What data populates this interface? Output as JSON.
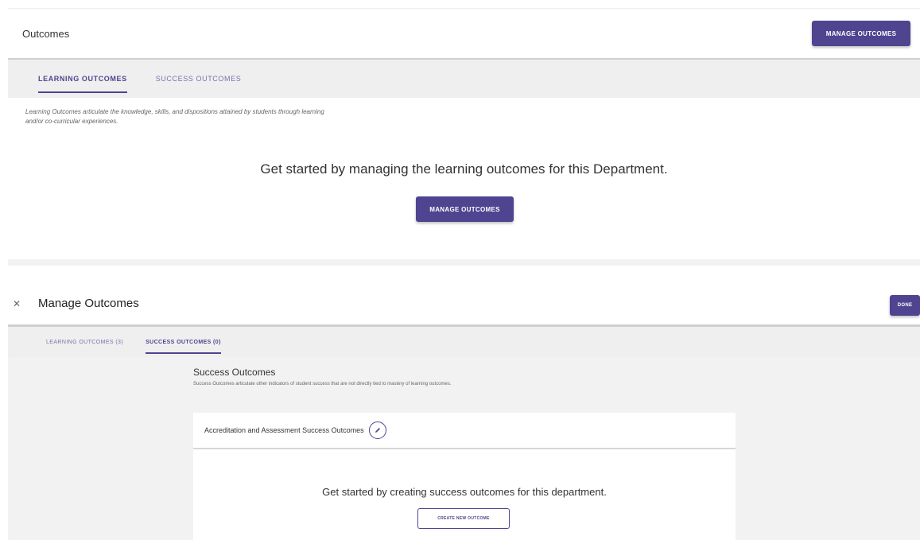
{
  "outcomes_panel": {
    "title": "Outcomes",
    "manage_button": "MANAGE OUTCOMES",
    "tabs": [
      {
        "label": "LEARNING OUTCOMES",
        "active": true
      },
      {
        "label": "SUCCESS OUTCOMES",
        "active": false
      }
    ],
    "description": "Learning Outcomes articulate the knowledge, skills, and dispositions attained by students through learning and/or co-curricular experiences.",
    "empty_message": "Get started by managing the learning outcomes for this Department.",
    "center_button": "MANAGE OUTCOMES"
  },
  "manage_modal": {
    "close_icon": "close-icon",
    "title": "Manage Outcomes",
    "done_button": "DONE",
    "tabs": [
      {
        "label": "LEARNING OUTCOMES (3)",
        "active": false
      },
      {
        "label": "SUCCESS OUTCOMES (0)",
        "active": true
      }
    ],
    "section_title": "Success Outcomes",
    "section_description": "Success Outcomes articulate other indicators of student success that are not directly tied to mastery of learning outcomes.",
    "card": {
      "title": "Accreditation and Assessment Success Outcomes",
      "edit_icon": "pencil-icon",
      "empty_message": "Get started by creating success outcomes for this department.",
      "create_button": "CREATE NEW OUTCOME"
    }
  },
  "colors": {
    "accent": "#4f4490",
    "tab_inactive": "#7a72ad",
    "tabbar_bg": "#efefef"
  }
}
